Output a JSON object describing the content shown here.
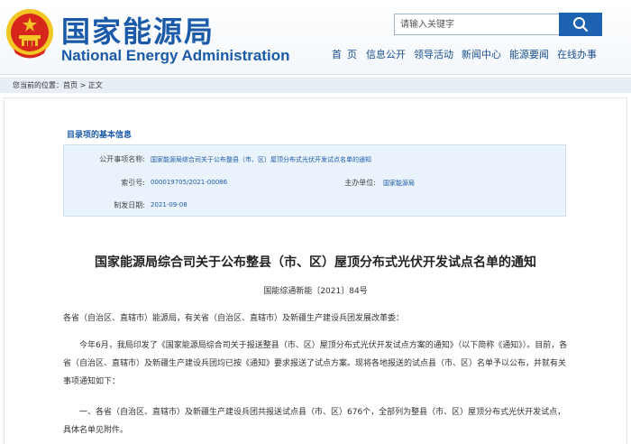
{
  "header": {
    "site_name_cn": "国家能源局",
    "site_name_en": "National Energy Administration",
    "search_placeholder": "请输入关键字"
  },
  "nav": [
    {
      "label": "首页"
    },
    {
      "label": "信息公开"
    },
    {
      "label": "领导活动"
    },
    {
      "label": "新闻中心"
    },
    {
      "label": "能源要闻"
    },
    {
      "label": "在线办事"
    }
  ],
  "breadcrumb": {
    "prefix": "您当前的位置：",
    "home": "首页",
    "sep1": " > ",
    "current": "正文"
  },
  "info": {
    "section_title": "目录项的基本信息",
    "rows": [
      {
        "label": "公开事项名称:",
        "value": "国家能源局综合司关于公布整县（市、区）屋顶分布式光伏开发试点名单的通知"
      },
      {
        "label": "索引号:",
        "value": "000019705/2021-00086"
      },
      {
        "label": "主办单位:",
        "value": "国家能源局"
      },
      {
        "label": "制发日期:",
        "value": "2021-09-08"
      }
    ]
  },
  "article": {
    "title": "国家能源局综合司关于公布整县（市、区）屋顶分布式光伏开发试点名单的通知",
    "doc_number": "国能综通新能〔2021〕84号",
    "paragraphs": [
      "各省（自治区、直辖市）能源局，有关省（自治区、直辖市）及新疆生产建设兵团发展改革委：",
      "今年6月，我局印发了《国家能源局综合司关于报送整县（市、区）屋顶分布式光伏开发试点方案的通知》（以下简称《通知》）。目前，各省（自治区、直辖市）及新疆生产建设兵团均已按《通知》要求报送了试点方案。现将各地报送的试点县（市、区）名单予以公布，并就有关事项通知如下：",
      "一、各省（自治区、直辖市）及新疆生产建设兵团共报送试点县（市、区）676个，全部列为整县（市、区）屋顶分布式光伏开发试点，具体名单见附件。"
    ]
  },
  "colors": {
    "brand_blue": "#1a5aa8",
    "emblem_red": "#d7261c",
    "emblem_gold": "#f3c623"
  }
}
